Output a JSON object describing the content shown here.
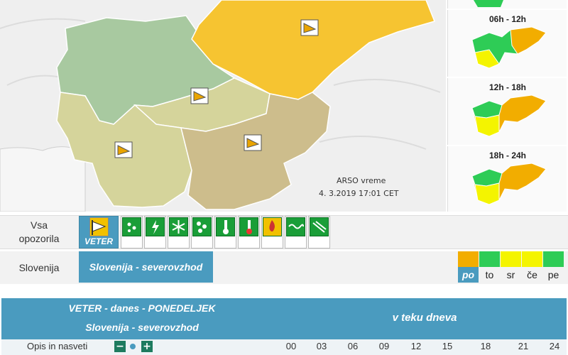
{
  "map": {
    "source_label": "ARSO vreme",
    "timestamp": "4. 3.2019   17:01 CET",
    "colors": {
      "background": "#efefef",
      "teal": "#a8c9a0",
      "olive": "#d5d49b",
      "tan": "#cdbd8c",
      "orange": "#f6c431"
    }
  },
  "panels": [
    {
      "label": "06h - 12h"
    },
    {
      "label": "12h - 18h"
    },
    {
      "label": "18h - 24h"
    }
  ],
  "filter": {
    "all_label_line1": "Vsa",
    "all_label_line2": "opozorila",
    "active_label": "VETER",
    "icons": [
      "wind-icon",
      "rain-icon",
      "thunderstorm-icon",
      "snow-icon",
      "ice-icon",
      "low-temperature-icon",
      "high-temperature-icon",
      "fire-icon",
      "coastal-icon",
      "fog-icon"
    ]
  },
  "region": {
    "label": "Slovenija",
    "selected": "Slovenija - severovzhod"
  },
  "days": [
    {
      "label": "po",
      "color": "#f2ad00"
    },
    {
      "label": "to",
      "color": "#2ecc56"
    },
    {
      "label": "sr",
      "color": "#f4f400"
    },
    {
      "label": "če",
      "color": "#f4f400"
    },
    {
      "label": "pe",
      "color": "#2ecc56"
    }
  ],
  "table": {
    "title": "VETER - danes - PONEDELJEK",
    "region": "Slovenija - severovzhod",
    "during_day": "v teku dneva",
    "description_label": "Opis in nasveti",
    "hours": [
      "00",
      "03",
      "06",
      "09",
      "12",
      "15",
      "18",
      "21",
      "24"
    ]
  }
}
